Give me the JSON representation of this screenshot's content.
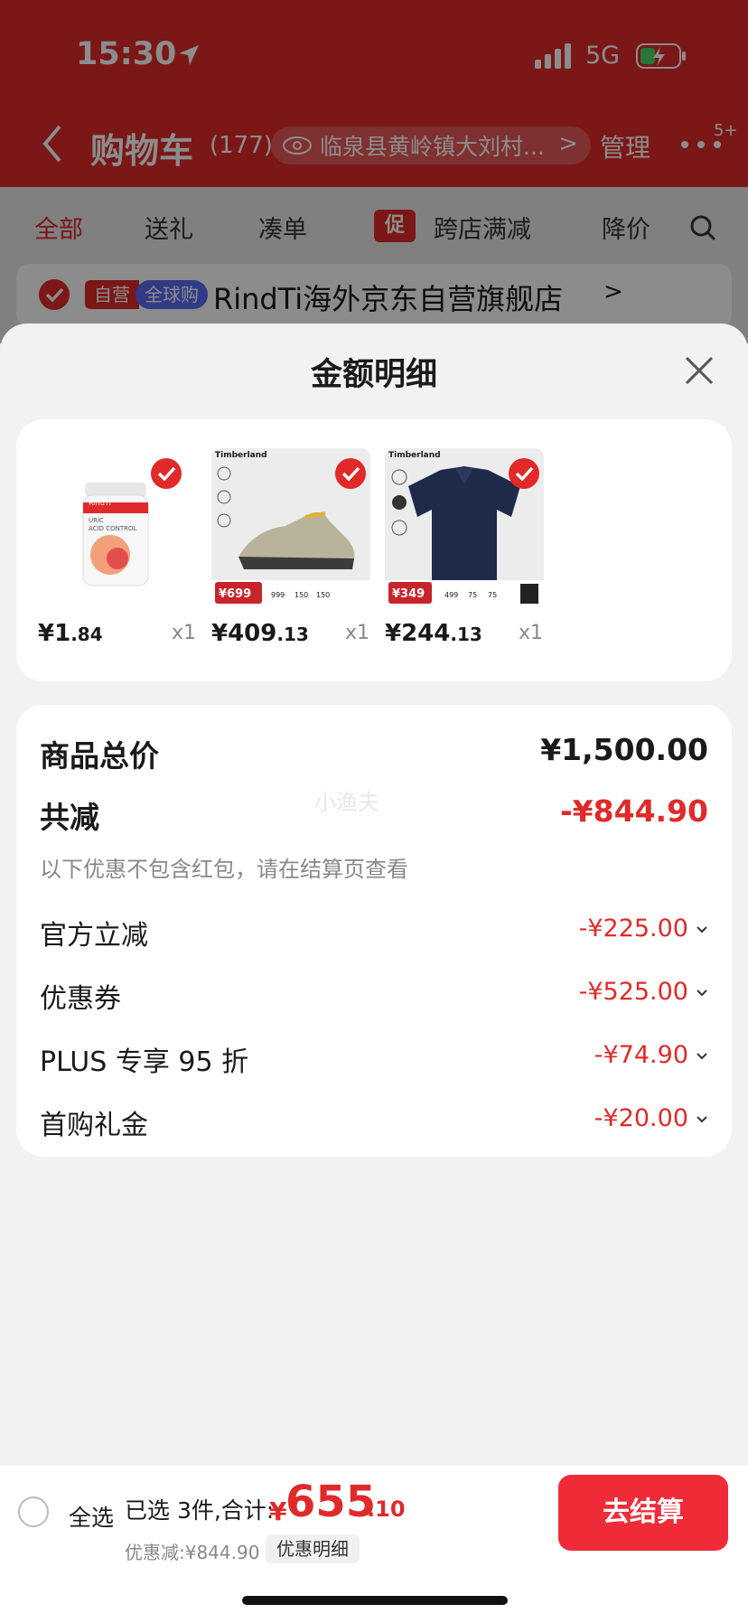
{
  "status_bar": {
    "time": "15:30",
    "network": "5G"
  },
  "nav": {
    "title": "购物车",
    "count": "(177)",
    "address": "临泉县黄岭镇大刘村...",
    "address_chevron": ">",
    "manage": "管理",
    "badge": "5+"
  },
  "tabs": [
    {
      "label": "全部",
      "active": true
    },
    {
      "label": "送礼"
    },
    {
      "label": "凑单"
    },
    {
      "label": "跨店满减",
      "tag": "促"
    },
    {
      "label": "降价"
    }
  ],
  "store": {
    "tag_self": "自营",
    "tag_global": "全球购",
    "name": "RindTi海外京东自营旗舰店",
    "chevron": ">"
  },
  "sheet": {
    "title": "金额明细",
    "watermark": "小渔夫"
  },
  "products": [
    {
      "price_int": "¥1",
      "price_dec": ".84",
      "qty": "x1",
      "image": "supplement-jar",
      "brand": "RindTi",
      "label_lines": [
        "URIC",
        "ACID CONTROL"
      ]
    },
    {
      "price_int": "¥409",
      "price_dec": ".13",
      "qty": "x1",
      "image": "timberland-sneaker",
      "brand": "Timberland",
      "tag_price": "¥699",
      "tag_prices": [
        "999",
        "150",
        "150"
      ]
    },
    {
      "price_int": "¥244",
      "price_dec": ".13",
      "qty": "x1",
      "image": "timberland-polo",
      "brand": "Timberland",
      "tag_price": "¥349",
      "tag_prices": [
        "499",
        "75",
        "75"
      ]
    }
  ],
  "summary": {
    "total_label": "商品总价",
    "total_value": "¥1,500.00",
    "reduce_label": "共减",
    "reduce_value": "-¥844.90",
    "note": "以下优惠不包含红包，请在结算页查看",
    "discounts": [
      {
        "label": "官方立减",
        "value": "-¥225.00"
      },
      {
        "label": "优惠券",
        "value": "-¥525.00"
      },
      {
        "label": "PLUS 专享 95 折",
        "value": "-¥74.90"
      },
      {
        "label": "首购礼金",
        "value": "-¥20.00"
      }
    ]
  },
  "bottom": {
    "select_all": "全选",
    "selected": "已选 3件,合计:",
    "total_symbol": "¥",
    "total_int": "655",
    "total_dec": ".10",
    "discount": "优惠减:¥844.90",
    "detail_button": "优惠明细",
    "checkout": "去结算"
  },
  "colors": {
    "accent": "#e02a2a",
    "checkout": "#f02b38",
    "global_tag": "#5a6bf2",
    "navy_polo": "#1e2a4a"
  }
}
